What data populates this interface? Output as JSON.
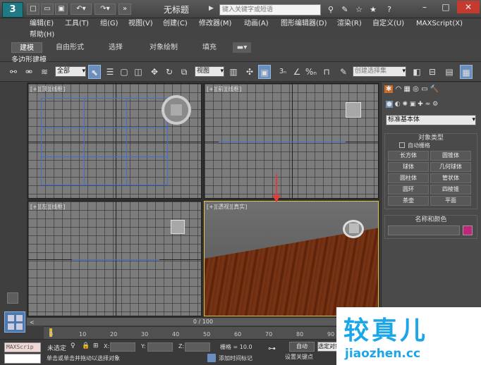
{
  "app": {
    "logo_label": "3",
    "window_title": "无标题",
    "search_placeholder": "键入关键字或短语"
  },
  "menus": [
    "编辑(E)",
    "工具(T)",
    "组(G)",
    "视图(V)",
    "创建(C)",
    "修改器(M)",
    "动画(A)",
    "图形编辑器(D)",
    "渲染(R)",
    "自定义(U)",
    "MAXScript(X)"
  ],
  "menu_help": "帮助(H)",
  "ribbon": {
    "tabs": [
      "建模",
      "自由形式",
      "选择",
      "对象绘制",
      "填充"
    ],
    "sub_label": "多边形建模"
  },
  "toolbar": {
    "selection_filter": "全部",
    "ref_coord": "视图",
    "named_selection": "创建选择集"
  },
  "viewports": {
    "top": "[+][顶][线框]",
    "front": "[+][前][线框]",
    "left": "[+][左][线框]",
    "perspective": "[+][透视][真实]"
  },
  "command_panel": {
    "category": "标准基本体",
    "object_type_title": "对象类型",
    "autogrid_label": "自动栅格",
    "primitives": [
      "长方体",
      "圆锥体",
      "球体",
      "几何球体",
      "圆柱体",
      "管状体",
      "圆环",
      "四棱锥",
      "茶壶",
      "平面"
    ],
    "name_color_title": "名称和颜色",
    "object_color": "#c2257a"
  },
  "timeline": {
    "frame_label": "0 / 100",
    "ticks": [
      "0",
      "10",
      "20",
      "30",
      "40",
      "50",
      "60",
      "70",
      "80",
      "90"
    ]
  },
  "status": {
    "maxscript_label": "MAXScrip",
    "selection_status": "未选定",
    "x_label": "X:",
    "y_label": "Y:",
    "z_label": "Z:",
    "grid_label": "栅格 = 10.0",
    "auto_label": "自动",
    "selected_label": "选定对象",
    "set_key_label": "设置关键点",
    "add_time_tag": "添加时间标记",
    "prompt": "单击或单击并拖动以选择对象"
  },
  "watermark": {
    "brand": "较真儿",
    "url": "jiaozhen.cc"
  }
}
